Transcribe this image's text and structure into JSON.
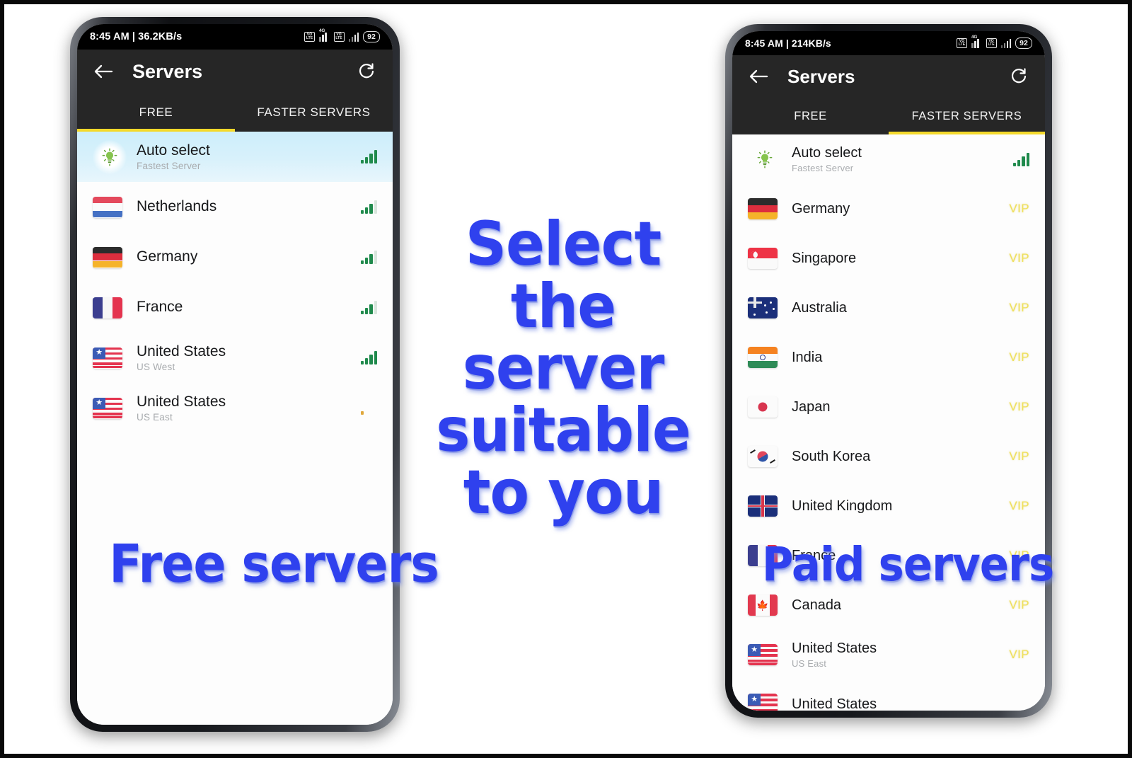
{
  "captions": {
    "center_line1": "Select the",
    "center_line2": "server",
    "center_line3": "suitable",
    "center_line4": "to you",
    "free": "Free servers",
    "paid": "Paid servers",
    "color": "#2f41ee"
  },
  "phone_left": {
    "statusbar": {
      "time": "8:45 AM | 36.2KB/s",
      "network_label": "4G",
      "battery": "92",
      "sim_icon_text": "VO LTE"
    },
    "appbar": {
      "back_icon": "arrow-left-icon",
      "title": "Servers",
      "refresh_icon": "refresh-icon"
    },
    "tabs": [
      {
        "label": "FREE",
        "active": true
      },
      {
        "label": "FASTER SERVERS",
        "active": false
      }
    ],
    "accent": "#f4d92b",
    "rows": [
      {
        "title": "Auto select",
        "sub": "Fastest Server",
        "flag": "bulb",
        "signal": 4,
        "selected": true
      },
      {
        "title": "Netherlands",
        "sub": "",
        "flag": "nl",
        "signal": 3,
        "selected": false
      },
      {
        "title": "Germany",
        "sub": "",
        "flag": "de",
        "signal": 3,
        "selected": false
      },
      {
        "title": "France",
        "sub": "",
        "flag": "fr",
        "signal": 3,
        "selected": false
      },
      {
        "title": "United States",
        "sub": "US West",
        "flag": "us",
        "signal": 4,
        "selected": false
      },
      {
        "title": "United States",
        "sub": "US East",
        "flag": "us",
        "signal": 1,
        "selected": false
      }
    ]
  },
  "phone_right": {
    "statusbar": {
      "time": "8:45 AM | 214KB/s",
      "network_label": "4G",
      "battery": "92",
      "sim_icon_text": "VO LTE"
    },
    "appbar": {
      "back_icon": "arrow-left-icon",
      "title": "Servers",
      "refresh_icon": "refresh-icon"
    },
    "tabs": [
      {
        "label": "FREE",
        "active": false
      },
      {
        "label": "FASTER SERVERS",
        "active": true
      }
    ],
    "accent": "#f4d92b",
    "vip_label": "VIP",
    "rows": [
      {
        "title": "Auto select",
        "sub": "Fastest Server",
        "flag": "bulb",
        "badge": "",
        "signal": 4
      },
      {
        "title": "Germany",
        "sub": "",
        "flag": "de",
        "badge": "VIP",
        "signal": 0
      },
      {
        "title": "Singapore",
        "sub": "",
        "flag": "sg",
        "badge": "VIP",
        "signal": 0
      },
      {
        "title": "Australia",
        "sub": "",
        "flag": "au",
        "badge": "VIP",
        "signal": 0
      },
      {
        "title": "India",
        "sub": "",
        "flag": "in",
        "badge": "VIP",
        "signal": 0
      },
      {
        "title": "Japan",
        "sub": "",
        "flag": "jp",
        "badge": "VIP",
        "signal": 0
      },
      {
        "title": "South Korea",
        "sub": "",
        "flag": "kr",
        "badge": "VIP",
        "signal": 0
      },
      {
        "title": "United Kingdom",
        "sub": "",
        "flag": "gb",
        "badge": "VIP",
        "signal": 0
      },
      {
        "title": "France",
        "sub": "",
        "flag": "fr",
        "badge": "VIP",
        "signal": 0
      },
      {
        "title": "Canada",
        "sub": "",
        "flag": "ca",
        "badge": "VIP",
        "signal": 0
      },
      {
        "title": "United States",
        "sub": "US East",
        "flag": "us",
        "badge": "VIP",
        "signal": 0
      },
      {
        "title": "United States",
        "sub": "",
        "flag": "us",
        "badge": "",
        "signal": 0
      }
    ]
  }
}
